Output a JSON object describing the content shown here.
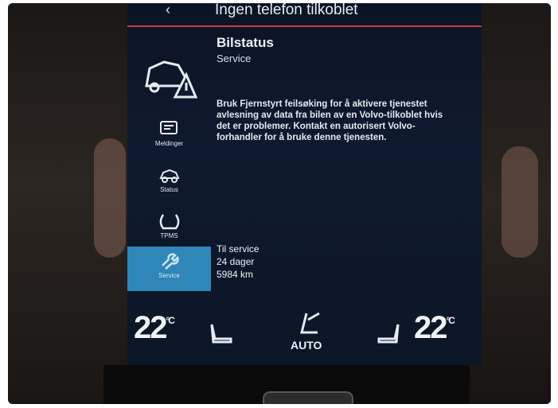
{
  "header": {
    "title": "Ingen telefon tilkoblet"
  },
  "sidebar": {
    "items": [
      {
        "label": "Meldinger",
        "icon": "messages-icon"
      },
      {
        "label": "Status",
        "icon": "car-status-icon"
      },
      {
        "label": "TPMS",
        "icon": "tire-pressure-icon"
      },
      {
        "label": "Service",
        "icon": "service-icon",
        "active": true
      }
    ]
  },
  "content": {
    "title": "Bilstatus",
    "subtitle": "Service",
    "body": "Bruk Fjernstyrt feilsøking for å aktivere tjenestet avlesning av data fra bilen av en Volvo-tilkoblet hvis det er problemer. Kontakt en autorisert Volvo-forhandler for å bruke denne tjenesten.",
    "service": {
      "label": "Til service",
      "days": "24 dager",
      "distance": "5984 km"
    }
  },
  "climate": {
    "left_temp": "22",
    "right_temp": "22",
    "unit": "°C",
    "auto_label": "AUTO"
  },
  "colors": {
    "accent_red": "#c8383a",
    "active_blue": "#2f86b8",
    "screen_bg": "#0e1a2f"
  }
}
